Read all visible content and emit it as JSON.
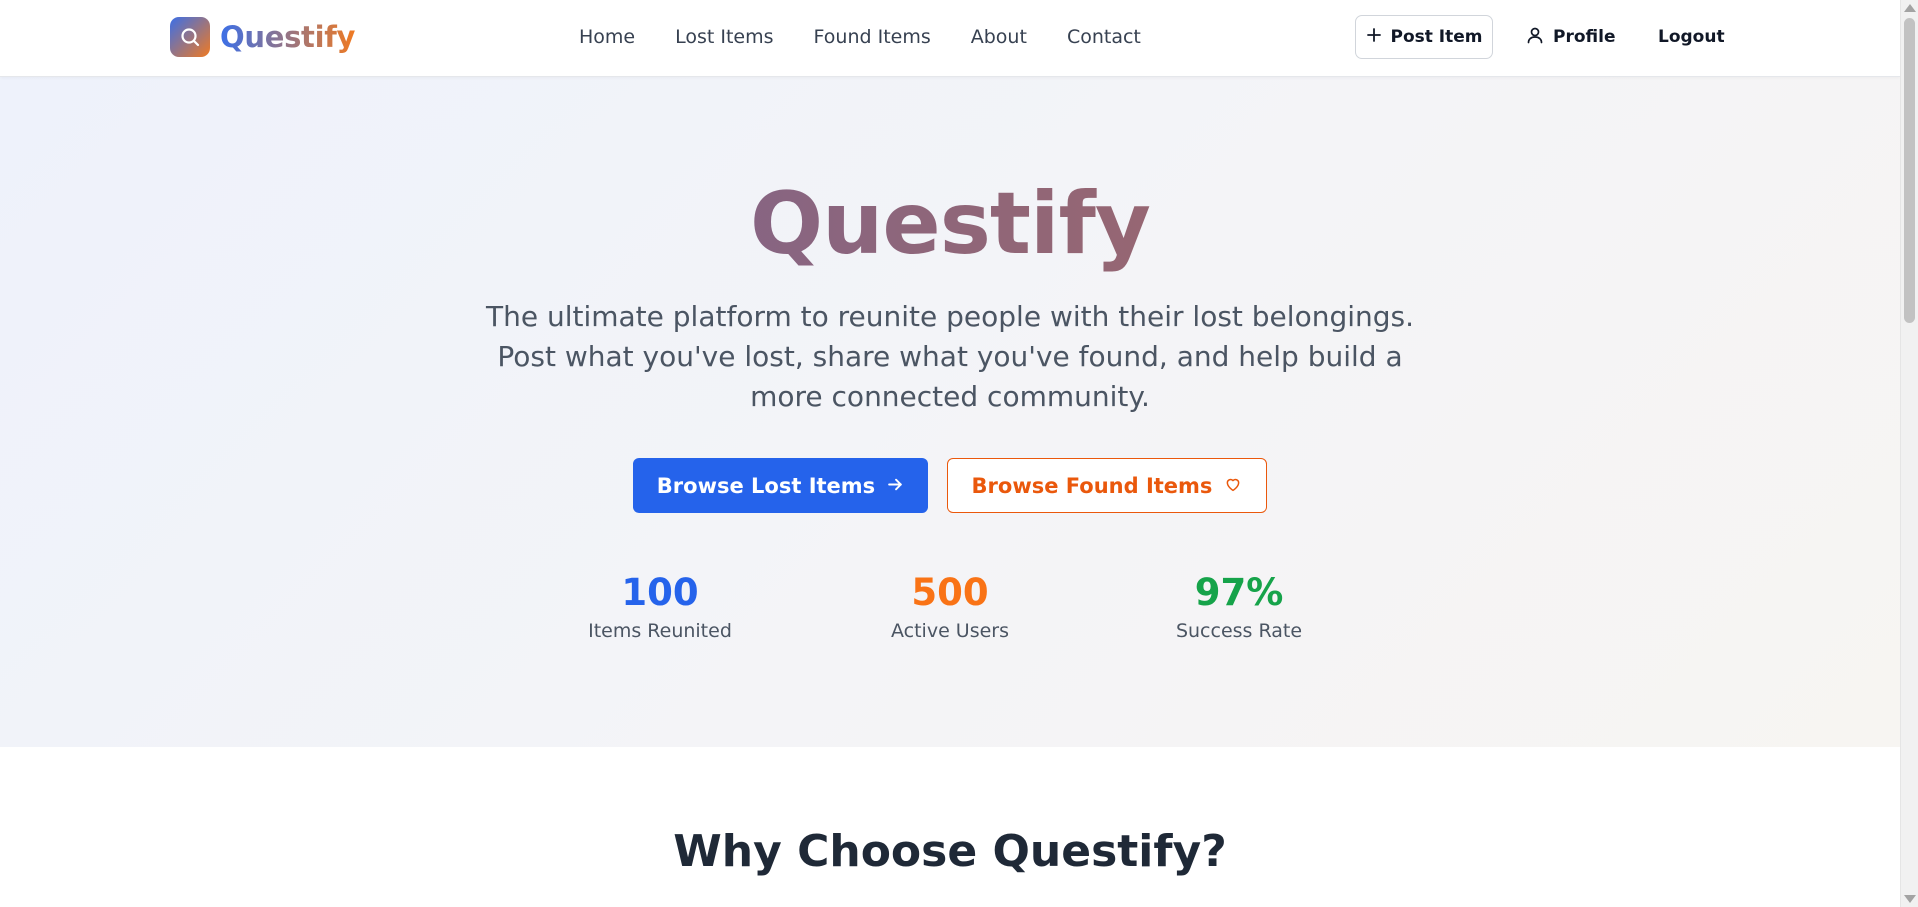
{
  "header": {
    "brand": "Questify",
    "nav": [
      "Home",
      "Lost Items",
      "Found Items",
      "About",
      "Contact"
    ],
    "post_item": "Post Item",
    "profile": "Profile",
    "logout": "Logout"
  },
  "hero": {
    "title": "Questify",
    "subtitle": "The ultimate platform to reunite people with their lost belongings. Post what you've lost, share what you've found, and help build a more connected community.",
    "browse_lost": "Browse Lost Items",
    "browse_found": "Browse Found Items",
    "stats": [
      {
        "value": "100",
        "label": "Items Reunited",
        "color": "#2563eb"
      },
      {
        "value": "500",
        "label": "Active Users",
        "color": "#f97316"
      },
      {
        "value": "97%",
        "label": "Success Rate",
        "color": "#16a34a"
      }
    ]
  },
  "why": {
    "title": "Why Choose Questify?"
  },
  "colors": {
    "primary": "#2563eb",
    "accent": "#ea580c",
    "success": "#16a34a"
  },
  "icons": {
    "brand": "search-icon",
    "post": "plus-icon",
    "profile": "user-icon",
    "lost": "arrow-right-icon",
    "found": "heart-icon"
  }
}
